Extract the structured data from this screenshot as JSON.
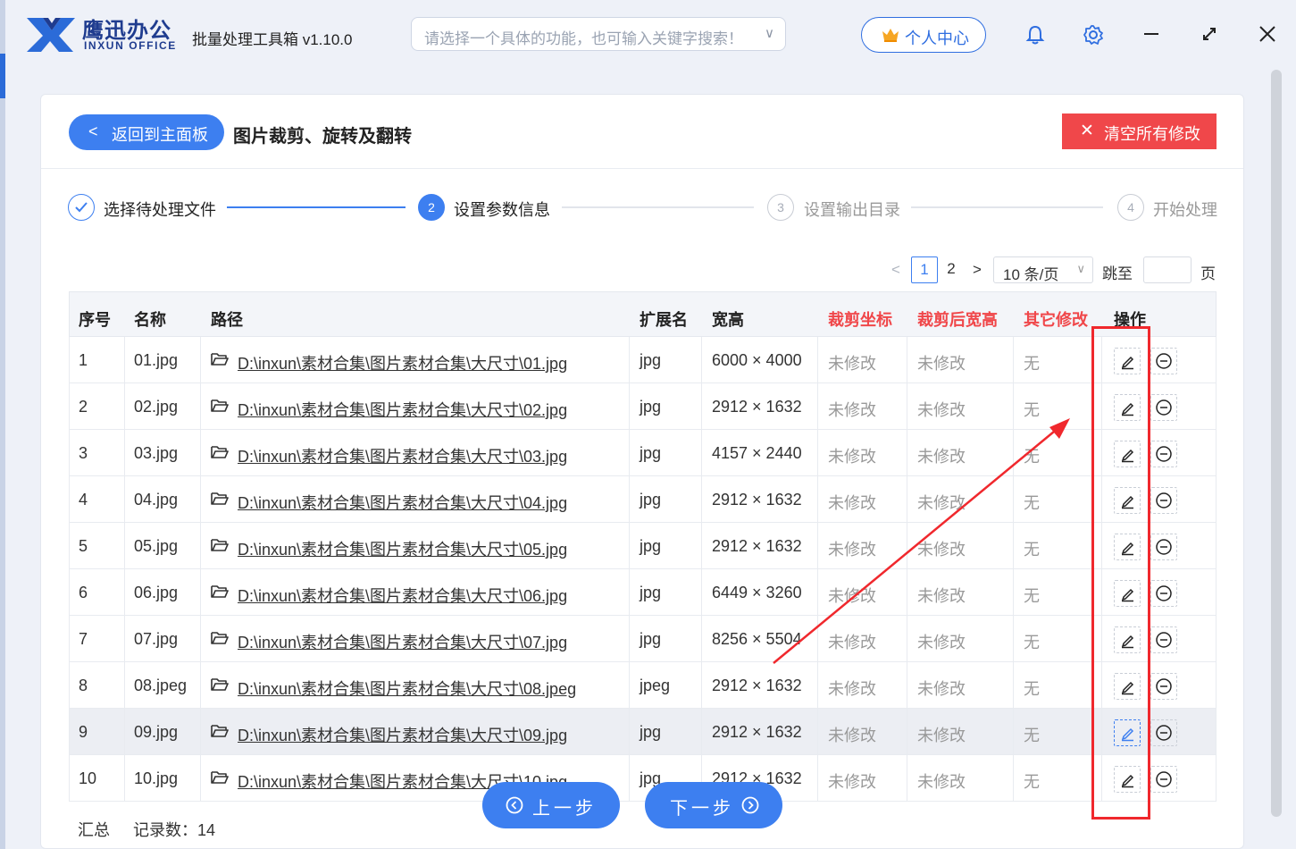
{
  "app": {
    "brand_cn": "鹰迅办公",
    "brand_en": "INXUN OFFICE",
    "title": "批量处理工具箱 v1.10.0",
    "search_placeholder": "请选择一个具体的功能，也可输入关键字搜索！",
    "user_center": "个人中心"
  },
  "page": {
    "back_label": "返回到主面板",
    "title": "图片裁剪、旋转及翻转",
    "clear_label": "清空所有修改"
  },
  "steps": [
    {
      "num": "✓",
      "label": "选择待处理文件",
      "state": "done"
    },
    {
      "num": "2",
      "label": "设置参数信息",
      "state": "active"
    },
    {
      "num": "3",
      "label": "设置输出目录",
      "state": "pending"
    },
    {
      "num": "4",
      "label": "开始处理",
      "state": "pending"
    }
  ],
  "pagination": {
    "pages": [
      "1",
      "2"
    ],
    "current": "1",
    "page_size": "10 条/页",
    "jump_label": "跳至",
    "page_unit": "页"
  },
  "table": {
    "headers": {
      "index": "序号",
      "name": "名称",
      "path": "路径",
      "ext": "扩展名",
      "size": "宽高",
      "crop_coords": "裁剪坐标",
      "crop_size": "裁剪后宽高",
      "other": "其它修改",
      "actions": "操作"
    },
    "rows": [
      {
        "index": "1",
        "name": "01.jpg",
        "path": "D:\\inxun\\素材合集\\图片素材合集\\大尺寸\\01.jpg",
        "ext": "jpg",
        "size": "6000 × 4000",
        "crop_coords": "未修改",
        "crop_size": "未修改",
        "other": "无"
      },
      {
        "index": "2",
        "name": "02.jpg",
        "path": "D:\\inxun\\素材合集\\图片素材合集\\大尺寸\\02.jpg",
        "ext": "jpg",
        "size": "2912 × 1632",
        "crop_coords": "未修改",
        "crop_size": "未修改",
        "other": "无"
      },
      {
        "index": "3",
        "name": "03.jpg",
        "path": "D:\\inxun\\素材合集\\图片素材合集\\大尺寸\\03.jpg",
        "ext": "jpg",
        "size": "4157 × 2440",
        "crop_coords": "未修改",
        "crop_size": "未修改",
        "other": "无"
      },
      {
        "index": "4",
        "name": "04.jpg",
        "path": "D:\\inxun\\素材合集\\图片素材合集\\大尺寸\\04.jpg",
        "ext": "jpg",
        "size": "2912 × 1632",
        "crop_coords": "未修改",
        "crop_size": "未修改",
        "other": "无"
      },
      {
        "index": "5",
        "name": "05.jpg",
        "path": "D:\\inxun\\素材合集\\图片素材合集\\大尺寸\\05.jpg",
        "ext": "jpg",
        "size": "2912 × 1632",
        "crop_coords": "未修改",
        "crop_size": "未修改",
        "other": "无"
      },
      {
        "index": "6",
        "name": "06.jpg",
        "path": "D:\\inxun\\素材合集\\图片素材合集\\大尺寸\\06.jpg",
        "ext": "jpg",
        "size": "6449 × 3260",
        "crop_coords": "未修改",
        "crop_size": "未修改",
        "other": "无"
      },
      {
        "index": "7",
        "name": "07.jpg",
        "path": "D:\\inxun\\素材合集\\图片素材合集\\大尺寸\\07.jpg",
        "ext": "jpg",
        "size": "8256 × 5504",
        "crop_coords": "未修改",
        "crop_size": "未修改",
        "other": "无"
      },
      {
        "index": "8",
        "name": "08.jpeg",
        "path": "D:\\inxun\\素材合集\\图片素材合集\\大尺寸\\08.jpeg",
        "ext": "jpeg",
        "size": "2912 × 1632",
        "crop_coords": "未修改",
        "crop_size": "未修改",
        "other": "无"
      },
      {
        "index": "9",
        "name": "09.jpg",
        "path": "D:\\inxun\\素材合集\\图片素材合集\\大尺寸\\09.jpg",
        "ext": "jpg",
        "size": "2912 × 1632",
        "crop_coords": "未修改",
        "crop_size": "未修改",
        "other": "无"
      },
      {
        "index": "10",
        "name": "10.jpg",
        "path": "D:\\inxun\\素材合集\\图片素材合集\\大尺寸\\10.jpg",
        "ext": "jpg",
        "size": "2912 × 1632",
        "crop_coords": "未修改",
        "crop_size": "未修改",
        "other": "无"
      }
    ],
    "summary_label": "汇总",
    "record_count": "记录数：14"
  },
  "nav": {
    "prev": "上一步",
    "next": "下一步"
  },
  "colors": {
    "primary": "#3d7ff0",
    "danger": "#f0474a",
    "annotation": "#f0282d"
  }
}
